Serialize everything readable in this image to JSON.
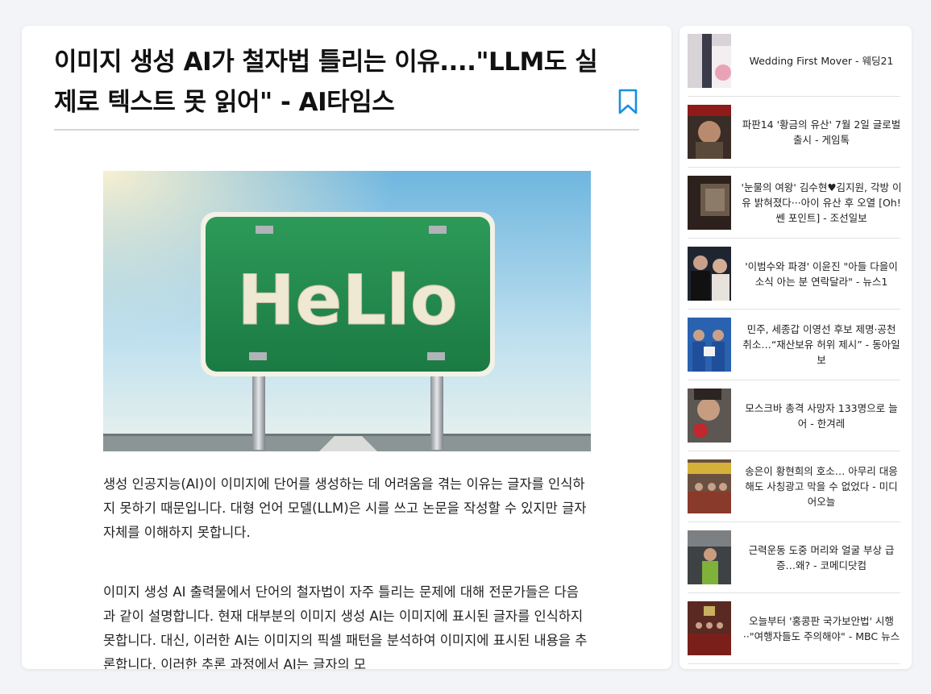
{
  "article": {
    "title": "이미지 생성 AI가 철자법 틀리는 이유....\"LLM도 실제로 텍스트 못 읽어\" - AI타임스",
    "hero_image": {
      "sign_text": "HeLlo"
    },
    "paragraphs": [
      "생성 인공지능(AI)이 이미지에 단어를 생성하는 데 어려움을 겪는 이유는 글자를 인식하지 못하기 때문입니다. 대형 언어 모델(LLM)은 시를 쓰고 논문을 작성할 수 있지만 글자 자체를 이해하지 못합니다.",
      "이미지 생성 AI 출력물에서 단어의 철자법이 자주 틀리는 문제에 대해 전문가들은 다음과 같이 설명합니다. 현재 대부분의 이미지 생성 AI는 이미지에 표시된 글자를 인식하지 못합니다. 대신, 이러한 AI는 이미지의 픽셀 패턴을 분석하여 이미지에 표시된 내용을 추론합니다. 이러한 추론 과정에서 AI는 글자의 모"
    ]
  },
  "colors": {
    "accent": "#1a8fe0",
    "sign_green": "#1f8a4c"
  },
  "sidebar": {
    "items": [
      {
        "title": "Wedding First Mover - 웨딩21"
      },
      {
        "title": "파판14 '황금의 유산' 7월 2일 글로벌 출시 - 게임톡"
      },
      {
        "title": "'눈물의 여왕' 김수현♥김지원, 각방 이유 밝혀졌다···아이 유산 후 오열 [Oh!쎈 포인트] - 조선일보"
      },
      {
        "title": "'이범수와 파경' 이윤진 \"아들 다을이 소식 아는 분 연락달라\" - 뉴스1"
      },
      {
        "title": "민주, 세종갑 이영선 후보 제명·공천 취소…“재산보유 허위 제시” - 동아일보"
      },
      {
        "title": "모스크바 총격 사망자 133명으로 늘어 - 한겨레"
      },
      {
        "title": "송은이 황현희의 호소… 아무리 대응해도 사칭광고 막을 수 없었다 - 미디어오늘"
      },
      {
        "title": "근력운동 도중 머리와 얼굴 부상 급증…왜? - 코메디닷컴"
      },
      {
        "title": "오늘부터 '홍콩판 국가보안법' 시행··\"여행자들도 주의해야\" - MBC 뉴스"
      }
    ]
  }
}
